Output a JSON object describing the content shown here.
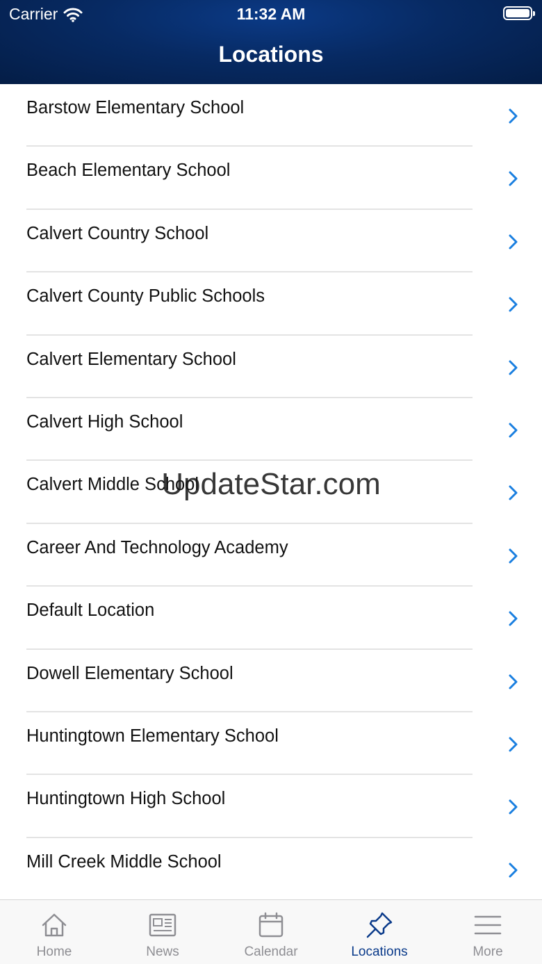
{
  "status_bar": {
    "carrier": "Carrier",
    "time": "11:32 AM"
  },
  "nav": {
    "title": "Locations"
  },
  "locations": [
    "Barstow Elementary School",
    "Beach Elementary School",
    "Calvert Country School",
    "Calvert County Public Schools",
    "Calvert Elementary School",
    "Calvert High School",
    "Calvert Middle School",
    "Career And Technology Academy",
    "Default Location",
    "Dowell Elementary School",
    "Huntingtown Elementary School",
    "Huntingtown High School",
    "Mill Creek Middle School"
  ],
  "watermark": "UpdateStar.com",
  "tabs": [
    {
      "label": "Home",
      "icon": "home-icon",
      "active": false
    },
    {
      "label": "News",
      "icon": "newspaper-icon",
      "active": false
    },
    {
      "label": "Calendar",
      "icon": "calendar-icon",
      "active": false
    },
    {
      "label": "Locations",
      "icon": "pushpin-icon",
      "active": true
    },
    {
      "label": "More",
      "icon": "menu-icon",
      "active": false
    }
  ],
  "colors": {
    "header": "#072a63",
    "accent": "#1a7fe0",
    "active_tab": "#0a3a8a",
    "inactive_tab": "#8e8e93"
  }
}
